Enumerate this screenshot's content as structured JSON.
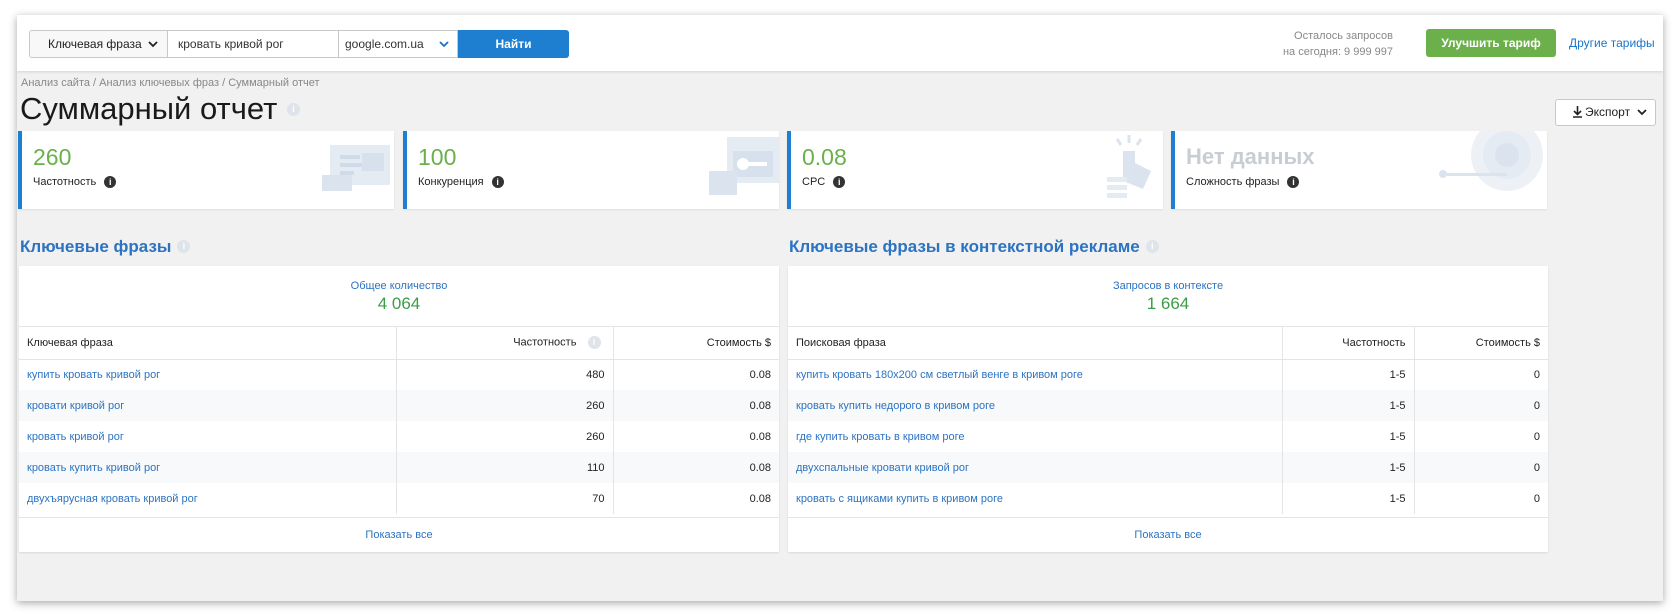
{
  "toolbar": {
    "mode_select": "Ключевая фраза",
    "query_value": "кровать кривой рог",
    "engine_select": "google.com.ua",
    "find_label": "Найти",
    "quota_line1": "Осталось запросов",
    "quota_line2": "на сегодня: 9 999 997",
    "upgrade_label": "Улучшить тариф",
    "plans_label": "Другие тарифы"
  },
  "breadcrumb": "Анализ сайта / Анализ ключевых фраз / Суммарный отчет",
  "page_title": "Суммарный отчет",
  "export_label": "Экспорт",
  "metrics": [
    {
      "value": "260",
      "label": "Частотность"
    },
    {
      "value": "100",
      "label": "Конкуренция"
    },
    {
      "value": "0.08",
      "label": "CPC"
    },
    {
      "value": "Нет данных",
      "label": "Сложность фразы"
    }
  ],
  "keywords_panel": {
    "title": "Ключевые фразы",
    "summary_label": "Общее количество",
    "summary_value": "4 064",
    "columns": [
      "Ключевая фраза",
      "Частотность",
      "Стоимость $"
    ],
    "rows": [
      {
        "phrase": "купить кровать кривой рог",
        "freq": "480",
        "cost": "0.08"
      },
      {
        "phrase": "кровати кривой рог",
        "freq": "260",
        "cost": "0.08"
      },
      {
        "phrase": "кровать кривой рог",
        "freq": "260",
        "cost": "0.08"
      },
      {
        "phrase": "кровать купить кривой рог",
        "freq": "110",
        "cost": "0.08"
      },
      {
        "phrase": "двухъярусная кровать кривой рог",
        "freq": "70",
        "cost": "0.08"
      }
    ],
    "show_all": "Показать все"
  },
  "context_panel": {
    "title": "Ключевые фразы в контекстной рекламе",
    "summary_label": "Запросов в контексте",
    "summary_value": "1 664",
    "columns": [
      "Поисковая фраза",
      "Частотность",
      "Стоимость $"
    ],
    "rows": [
      {
        "phrase": "купить кровать 180х200 см светлый венге в кривом роге",
        "freq": "1-5",
        "cost": "0"
      },
      {
        "phrase": "кровать купить недорого в кривом роге",
        "freq": "1-5",
        "cost": "0"
      },
      {
        "phrase": "где купить кровать в кривом роге",
        "freq": "1-5",
        "cost": "0"
      },
      {
        "phrase": "двухспальные кровати кривой рог",
        "freq": "1-5",
        "cost": "0"
      },
      {
        "phrase": "кровать с ящиками купить в кривом роге",
        "freq": "1-5",
        "cost": "0"
      }
    ],
    "show_all": "Показать все"
  },
  "colors": {
    "accent": "#1e7fd1",
    "positive": "#6ab04c",
    "link": "#2c73c2",
    "upgrade": "#6cb04b"
  },
  "icons": [
    "chevron-down-icon",
    "info-icon",
    "download-icon",
    "chart-illustration-icon",
    "key-illustration-icon",
    "hand-click-illustration-icon",
    "target-illustration-icon"
  ]
}
